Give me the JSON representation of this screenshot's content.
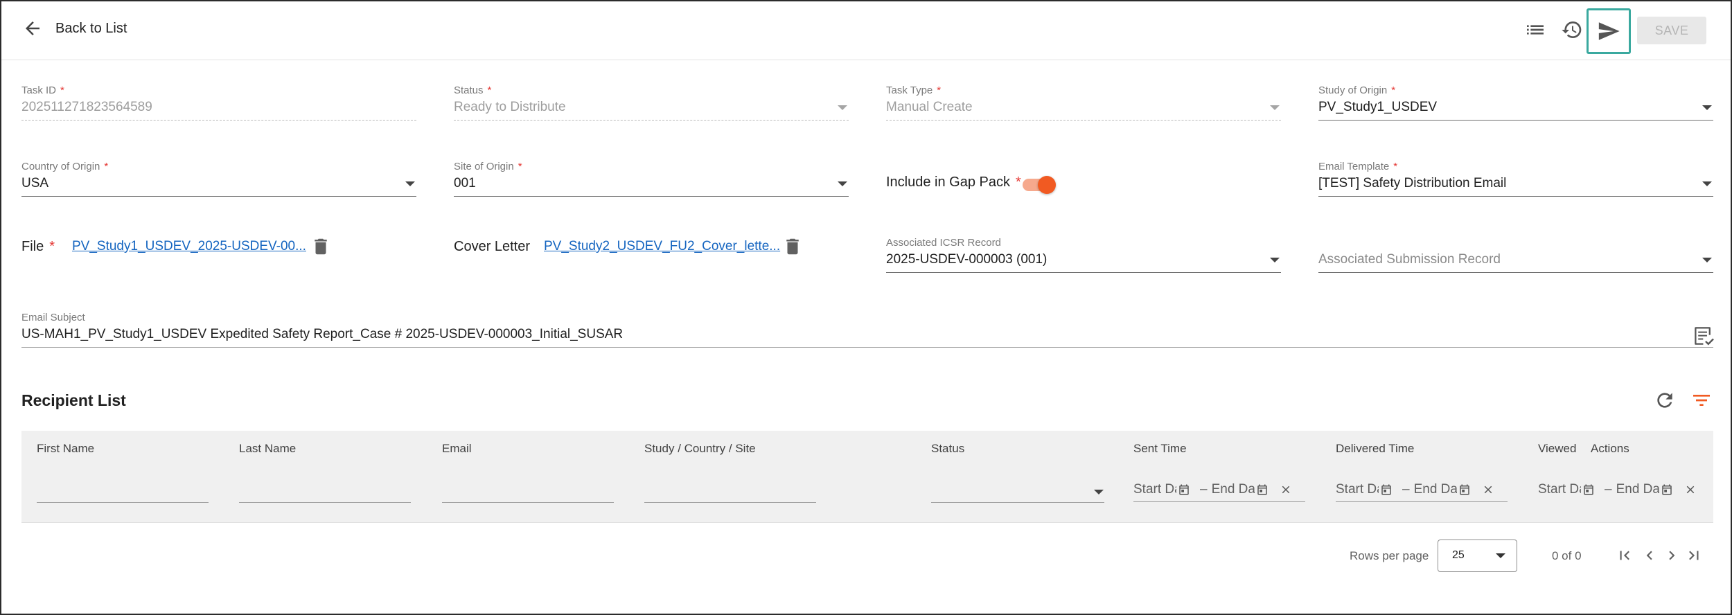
{
  "header": {
    "back_label": "Back to List",
    "save_label": "SAVE",
    "icons": [
      "list-icon",
      "history-icon",
      "send-icon"
    ]
  },
  "form": {
    "task_id": {
      "label": "Task ID",
      "required": "*",
      "value": "202511271823564589"
    },
    "status": {
      "label": "Status",
      "required": "*",
      "value": "Ready to Distribute"
    },
    "task_type": {
      "label": "Task Type",
      "required": "*",
      "value": "Manual Create"
    },
    "study_of_origin": {
      "label": "Study of Origin",
      "required": "*",
      "value": "PV_Study1_USDEV"
    },
    "country_of_origin": {
      "label": "Country of Origin",
      "required": "*",
      "value": "USA"
    },
    "site_of_origin": {
      "label": "Site of Origin",
      "required": "*",
      "value": "001"
    },
    "gap_pack": {
      "label": "Include in Gap Pack",
      "required": "*",
      "checked": true
    },
    "email_template": {
      "label": "Email Template",
      "required": "*",
      "value": "[TEST] Safety Distribution Email"
    },
    "file": {
      "label": "File",
      "required": "*",
      "link": "PV_Study1_USDEV_2025-USDEV-00..."
    },
    "cover_letter": {
      "label": "Cover Letter",
      "link": "PV_Study2_USDEV_FU2_Cover_lette..."
    },
    "associated_icsr": {
      "label": "Associated ICSR Record",
      "value": "2025-USDEV-000003 (001)"
    },
    "associated_submission": {
      "placeholder": "Associated Submission Record"
    },
    "email_subject": {
      "label": "Email Subject",
      "value": "US-MAH1_PV_Study1_USDEV Expedited Safety Report_Case # 2025-USDEV-000003_Initial_SUSAR"
    }
  },
  "recipients": {
    "title": "Recipient List",
    "columns": [
      "First Name",
      "Last Name",
      "Email",
      "Study / Country / Site",
      "Status",
      "Sent Time",
      "Delivered Time",
      "Viewed",
      "Actions"
    ],
    "date_filter": {
      "start": "Start Date",
      "end": "End Date",
      "separator": "–"
    },
    "rows": [],
    "pagination": {
      "rows_per_page_label": "Rows per page",
      "rows_per_page": "25",
      "range": "0 of 0"
    }
  },
  "colors": {
    "accent": "#f15a22",
    "link": "#1565c0",
    "focus_outline": "#3aa99f",
    "required": "#e53935"
  }
}
